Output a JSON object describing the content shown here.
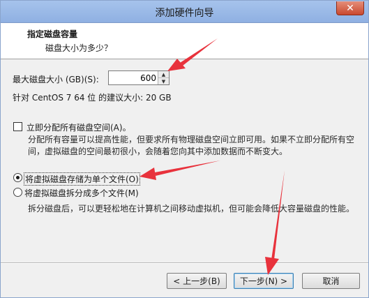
{
  "window": {
    "title": "添加硬件向导",
    "close_glyph": "✕"
  },
  "header": {
    "title": "指定磁盘容量",
    "subtitle": "磁盘大小为多少？"
  },
  "disk_size": {
    "label": "最大磁盘大小 (GB)(S):",
    "value": "600"
  },
  "recommend_text": "针对 CentOS 7 64 位 的建议大小: 20 GB",
  "allocate_now": {
    "label": "立即分配所有磁盘空间(A)。",
    "checked": false,
    "desc_line1": "分配所有容量可以提高性能，但要求所有物理磁盘空间立即可用。如果不立即分配所有空",
    "desc_line2": "间，虚拟磁盘的空间最初很小，会随着您向其中添加数据而不断变大。"
  },
  "options": {
    "single_file": {
      "label": "将虚拟磁盘存储为单个文件(O)",
      "selected": true
    },
    "multi_file": {
      "label": "将虚拟磁盘拆分成多个文件(M)",
      "selected": false
    },
    "multi_desc": "拆分磁盘后，可以更轻松地在计算机之间移动虚拟机，但可能会降低大容量磁盘的性能。"
  },
  "buttons": {
    "back": "< 上一步(B)",
    "next": "下一步(N) >",
    "cancel": "取消"
  },
  "colors": {
    "annotation_arrow": "#e8323c",
    "titlebar": "#9cbbe8",
    "close": "#c9492f"
  }
}
